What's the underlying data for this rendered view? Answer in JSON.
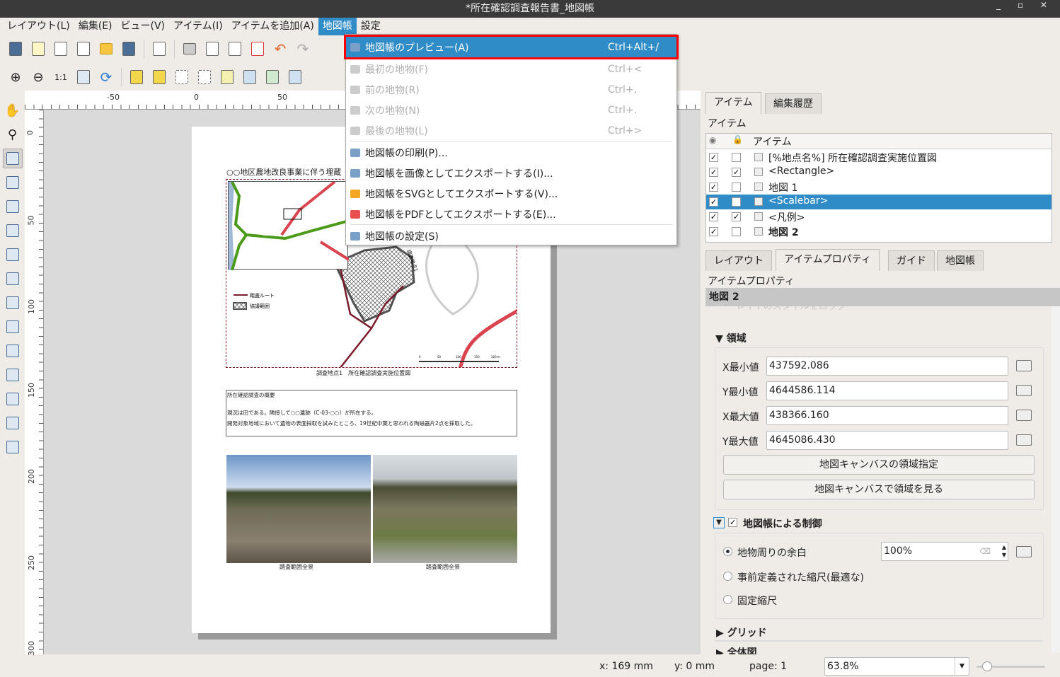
{
  "window": {
    "title": "*所在確認調査報告書_地図帳",
    "controls": "_ ▫ ✕"
  },
  "menubar": [
    "レイアウト(L)",
    "編集(E)",
    "ビュー(V)",
    "アイテム(I)",
    "アイテムを追加(A)",
    "地図帳",
    "設定"
  ],
  "atlas_menu": {
    "items": [
      {
        "label": "地図帳のプレビュー(A)",
        "shortcut": "Ctrl+Alt+/",
        "state": "highlighted",
        "icon": "atlas-preview-icon"
      },
      {
        "label": "最初の地物(F)",
        "shortcut": "Ctrl+<",
        "state": "disabled",
        "icon": "first-icon"
      },
      {
        "label": "前の地物(R)",
        "shortcut": "Ctrl+,",
        "state": "disabled",
        "icon": "prev-icon"
      },
      {
        "label": "次の地物(N)",
        "shortcut": "Ctrl+.",
        "state": "disabled",
        "icon": "next-icon"
      },
      {
        "label": "最後の地物(L)",
        "shortcut": "Ctrl+>",
        "state": "disabled",
        "icon": "last-icon"
      },
      {
        "label": "地図帳の印刷(P)...",
        "shortcut": "",
        "state": "normal",
        "icon": "print-icon"
      },
      {
        "label": "地図帳を画像としてエクスポートする(I)...",
        "shortcut": "",
        "state": "normal",
        "icon": "export-image-icon"
      },
      {
        "label": "地図帳をSVGとしてエクスポートする(V)...",
        "shortcut": "",
        "state": "normal",
        "icon": "export-svg-icon"
      },
      {
        "label": "地図帳をPDFとしてエクスポートする(E)...",
        "shortcut": "",
        "state": "normal",
        "icon": "export-pdf-icon"
      },
      {
        "label": "地図帳の設定(S)",
        "shortcut": "",
        "state": "normal",
        "icon": "atlas-settings-icon"
      }
    ]
  },
  "rulers": {
    "top": [
      "-50",
      "0",
      "50"
    ],
    "left": [
      "0",
      "50",
      "100",
      "150",
      "200",
      "250",
      "300"
    ]
  },
  "page": {
    "heading": "○○地区農地改良事業に伴う埋蔵",
    "legend": [
      "踏査ルート",
      "協議範囲"
    ],
    "map_label": "調査地点1",
    "road_label": "八幡平沢田線",
    "road_number": "227",
    "scale_ticks": [
      "0",
      "50",
      "100",
      "150",
      "200 m"
    ],
    "caption": "調査地点1　所在確認調査実施位置図",
    "summary_title": "所在確認調査の概要",
    "summary_lines": [
      "現況は田である。隣接して○○遺跡（C-03-○○）が所在する。",
      "開発対象地域において遺物の表面採取を試みたところ、19世紀中葉と思われる陶磁器片2点を採取した。"
    ],
    "photo_captions": [
      "踏査範囲全景",
      "踏査範囲全景"
    ]
  },
  "right": {
    "top_tabs": [
      "アイテム",
      "編集履歴"
    ],
    "items_title": "アイテム",
    "items_header": "アイテム",
    "items": [
      {
        "visible": true,
        "locked": false,
        "label": "[%地点名%] 所在確認調査実施位置図",
        "icon": "text-icon"
      },
      {
        "visible": true,
        "locked": true,
        "label": "<Rectangle>",
        "icon": "rectangle-icon"
      },
      {
        "visible": true,
        "locked": false,
        "label": "地図 1",
        "icon": "map-icon"
      },
      {
        "visible": true,
        "locked": false,
        "label": "<Scalebar>",
        "icon": "scalebar-icon",
        "selected": true
      },
      {
        "visible": true,
        "locked": true,
        "label": "<凡例>",
        "icon": "legend-icon"
      },
      {
        "visible": true,
        "locked": false,
        "label": "地図 2",
        "icon": "map-icon",
        "bold": true
      }
    ],
    "bottom_tabs": [
      "レイアウト",
      "アイテムプロパティ",
      "ガイド",
      "地図帳"
    ],
    "props_title": "アイテムプロパティ",
    "item_name": "地図 2",
    "clipped_text": "レイヤのスタイルをロック",
    "extent": {
      "title": "領域",
      "xmin_label": "X最小値",
      "xmin": "437592.086",
      "ymin_label": "Y最小値",
      "ymin": "4644586.114",
      "xmax_label": "X最大値",
      "xmax": "438366.160",
      "ymax_label": "Y最大値",
      "ymax": "4645086.430",
      "btn_set": "地図キャンバスの領域指定",
      "btn_view": "地図キャンバスで領域を見る"
    },
    "atlas_control": {
      "title": "地図帳による制御",
      "checked": true,
      "opt_margin": "地物周りの余白",
      "margin_value": "100%",
      "opt_predef": "事前定義された縮尺(最適な)",
      "opt_fixed": "固定縮尺",
      "selected": "margin"
    },
    "grid": "グリッド",
    "overview": "全体図"
  },
  "status": {
    "x": "x: 169 mm",
    "y": "y: 0 mm",
    "page": "page: 1",
    "zoom": "63.8%",
    "zoom_slider": 0.1
  }
}
